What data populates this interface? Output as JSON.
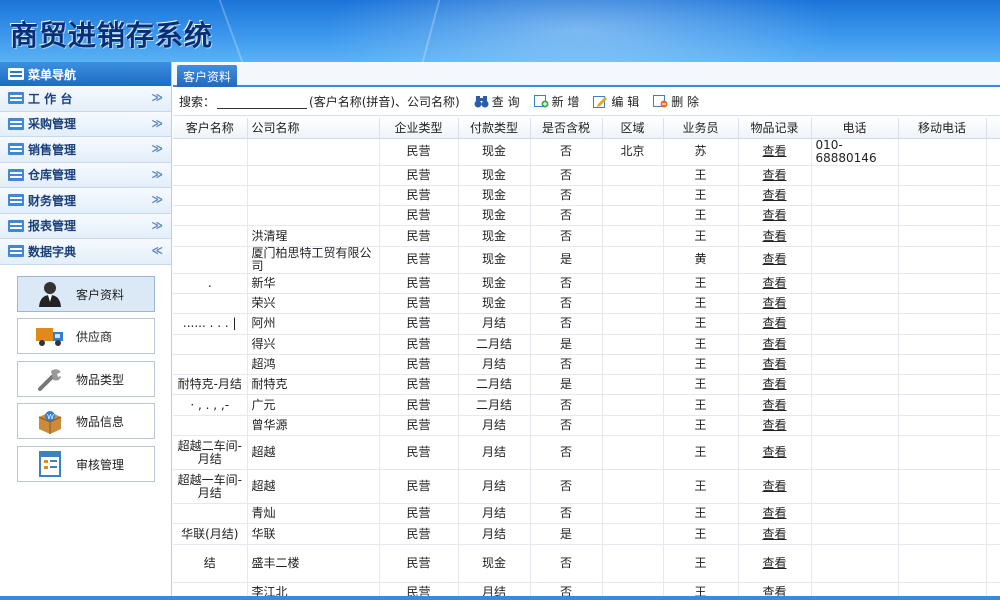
{
  "app": {
    "title": "商贸进销存系统"
  },
  "sidebar": {
    "header": "菜单导航",
    "menu": [
      {
        "label": "工 作 台",
        "chevron": "down"
      },
      {
        "label": "采购管理",
        "chevron": "down"
      },
      {
        "label": "销售管理",
        "chevron": "down"
      },
      {
        "label": "仓库管理",
        "chevron": "down"
      },
      {
        "label": "财务管理",
        "chevron": "down"
      },
      {
        "label": "报表管理",
        "chevron": "down"
      },
      {
        "label": "数据字典",
        "chevron": "up"
      }
    ],
    "submenu": [
      {
        "label": "客户资料",
        "icon": "user-icon",
        "active": true
      },
      {
        "label": "供应商",
        "icon": "truck-icon",
        "active": false
      },
      {
        "label": "物品类型",
        "icon": "wrench-icon",
        "active": false
      },
      {
        "label": "物品信息",
        "icon": "box-icon",
        "active": false
      },
      {
        "label": "审核管理",
        "icon": "document-icon",
        "active": false
      }
    ]
  },
  "tab": {
    "label": "客户资料"
  },
  "toolbar": {
    "search_label": "搜索：",
    "search_value": "",
    "search_hint": "(客户名称(拼音)、公司名称)",
    "query": "查 询",
    "add": "新 增",
    "edit": "编 辑",
    "delete": "删 除"
  },
  "table": {
    "columns": [
      "客户名称",
      "公司名称",
      "企业类型",
      "付款类型",
      "是否含税",
      "区域",
      "业务员",
      "物品记录",
      "电话",
      "移动电话"
    ],
    "rows": [
      [
        "",
        "",
        "民营",
        "现金",
        "否",
        "北京",
        "苏",
        "查看",
        "010-68880146",
        ""
      ],
      [
        "",
        "",
        "民营",
        "现金",
        "否",
        "",
        "王",
        "查看",
        "",
        ""
      ],
      [
        "",
        "",
        "民营",
        "现金",
        "否",
        "",
        "王",
        "查看",
        "",
        ""
      ],
      [
        "",
        "",
        "民营",
        "现金",
        "否",
        "",
        "王",
        "查看",
        "",
        ""
      ],
      [
        "",
        "洪清瑆",
        "民营",
        "现金",
        "否",
        "",
        "王",
        "查看",
        "",
        ""
      ],
      [
        "",
        "厦门柏思特工贸有限公司",
        "民营",
        "现金",
        "是",
        "",
        "黄",
        "查看",
        "",
        ""
      ],
      [
        ".",
        "新华",
        "民营",
        "现金",
        "否",
        "",
        "王",
        "查看",
        "",
        ""
      ],
      [
        "",
        "荣兴",
        "民营",
        "现金",
        "否",
        "",
        "王",
        "查看",
        "",
        ""
      ],
      [
        "...... . . . |",
        "阿州",
        "民营",
        "月结",
        "否",
        "",
        "王",
        "查看",
        "",
        ""
      ],
      [
        "",
        "得兴",
        "民营",
        "二月结",
        "是",
        "",
        "王",
        "查看",
        "",
        ""
      ],
      [
        "",
        "超鸿",
        "民营",
        "月结",
        "否",
        "",
        "王",
        "查看",
        "",
        ""
      ],
      [
        "耐特克-月结",
        "耐特克",
        "民营",
        "二月结",
        "是",
        "",
        "王",
        "查看",
        "",
        ""
      ],
      [
        "· , . , ,-",
        "广元",
        "民营",
        "二月结",
        "否",
        "",
        "王",
        "查看",
        "",
        ""
      ],
      [
        "",
        "曾华源",
        "民营",
        "月结",
        "否",
        "",
        "王",
        "查看",
        "",
        ""
      ],
      [
        "超越二车间-月结",
        "超越",
        "民营",
        "月结",
        "否",
        "",
        "王",
        "查看",
        "",
        ""
      ],
      [
        "超越一车间-月结",
        "超越",
        "民营",
        "月结",
        "否",
        "",
        "王",
        "查看",
        "",
        ""
      ],
      [
        "",
        "青灿",
        "民营",
        "月结",
        "否",
        "",
        "王",
        "查看",
        "",
        ""
      ],
      [
        "华联(月结)",
        "华联",
        "民营",
        "月结",
        "是",
        "",
        "王",
        "查看",
        "",
        ""
      ],
      [
        "结",
        "盛丰二楼",
        "民营",
        "现金",
        "否",
        "",
        "王",
        "查看",
        "",
        ""
      ],
      [
        "",
        "李江北",
        "民营",
        "月结",
        "否",
        "",
        "王",
        "查看",
        "",
        ""
      ]
    ]
  }
}
